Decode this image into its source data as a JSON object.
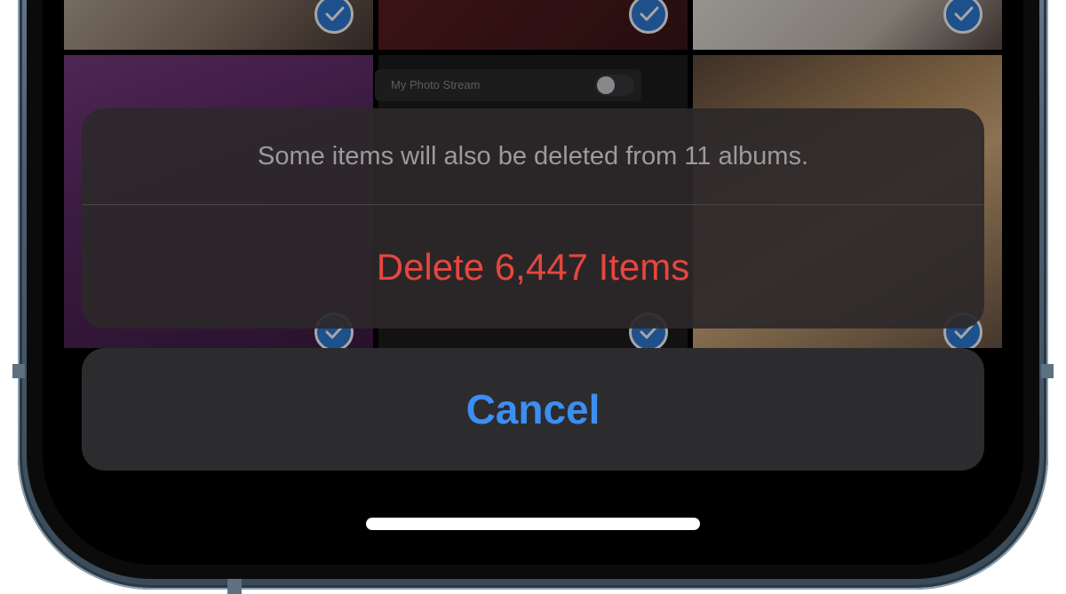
{
  "photo_grid": {
    "stream_label": "My Photo Stream",
    "selected_tiles": 6
  },
  "action_sheet": {
    "message": "Some items will also be deleted from 11 albums.",
    "delete_label": "Delete 6,447 Items",
    "cancel_label": "Cancel"
  },
  "colors": {
    "destructive": "#e5473e",
    "cancel": "#3d8ef2",
    "selection": "#2f7bd6"
  }
}
